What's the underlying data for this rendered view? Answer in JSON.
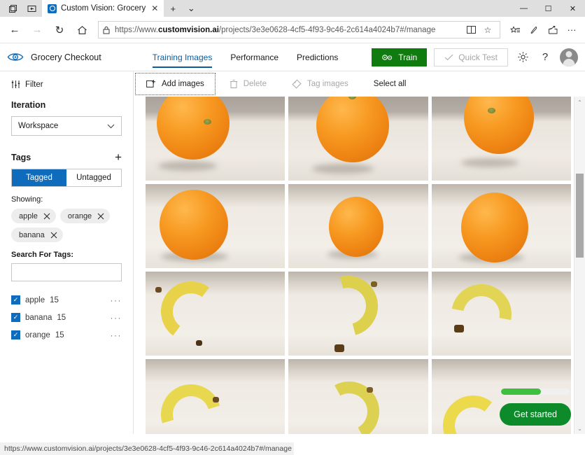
{
  "browser": {
    "window_controls": {
      "minimize": "—",
      "maximize": "☐",
      "close": "✕"
    },
    "tab": {
      "title": "Custom Vision: Grocery",
      "close_label": "✕",
      "favicon_name": "custom-vision-favicon"
    },
    "new_tab_label": "+",
    "tab_menu_label": "⌄",
    "sys_icons": {
      "tab_preview": "⧉",
      "set_aside": "⇤"
    },
    "nav": {
      "back": "←",
      "forward": "→",
      "refresh": "↻",
      "home": "⌂"
    },
    "address": {
      "lock_icon": "🔒",
      "url_scheme": "https://www.",
      "url_domain": "customvision.ai",
      "url_path": "/projects/3e3e0628-4cf5-4f93-9c46-2c614a4024b7#/manage",
      "full_url": "https://www.customvision.ai/projects/3e3e0628-4cf5-4f93-9c46-2c614a4024b7#/manage",
      "reading_view_icon": "▭",
      "favorite_icon": "☆"
    },
    "toolbar_icons": [
      "favorites-hub-icon",
      "notes-pen-icon",
      "share-icon",
      "settings-more-icon"
    ],
    "status_bar_url": "https://www.customvision.ai/projects/3e3e0628-4cf5-4f93-9c46-2c614a4024b7#/manage"
  },
  "app": {
    "logo_name": "custom-vision-eye-logo",
    "project_name": "Grocery Checkout",
    "tabs": [
      {
        "label": "Training Images",
        "active": true
      },
      {
        "label": "Performance",
        "active": false
      },
      {
        "label": "Predictions",
        "active": false
      }
    ],
    "train_button": {
      "label": "Train",
      "icon": "gears-icon",
      "color": "#107c10"
    },
    "quick_test_button": {
      "label": "Quick Test",
      "icon": "check-icon",
      "enabled": false
    },
    "settings_icon": "⚙",
    "help_icon": "?",
    "account_avatar": "user-avatar"
  },
  "sidebar": {
    "filter": {
      "label": "Filter",
      "icon": "filter-icon"
    },
    "iteration": {
      "title": "Iteration",
      "selected": "Workspace",
      "chevron": "⌄"
    },
    "tags": {
      "title": "Tags",
      "add_icon": "+",
      "toggle": {
        "tagged": "Tagged",
        "untagged": "Untagged",
        "selected": "Tagged"
      },
      "showing_label": "Showing:",
      "showing_pills": [
        {
          "label": "apple",
          "remove": "✕"
        },
        {
          "label": "orange",
          "remove": "✕"
        },
        {
          "label": "banana",
          "remove": "✕"
        }
      ],
      "search_label": "Search For Tags:",
      "search_value": "",
      "search_placeholder": "",
      "list": [
        {
          "label": "apple",
          "count": "15",
          "checked": true,
          "more": "···"
        },
        {
          "label": "banana",
          "count": "15",
          "checked": true,
          "more": "···"
        },
        {
          "label": "orange",
          "count": "15",
          "checked": true,
          "more": "···"
        }
      ]
    }
  },
  "commandbar": [
    {
      "label": "Add images",
      "icon": "add-image-icon",
      "enabled": true,
      "focused": true
    },
    {
      "label": "Delete",
      "icon": "trash-icon",
      "enabled": false,
      "focused": false
    },
    {
      "label": "Tag images",
      "icon": "tag-icon",
      "enabled": false,
      "focused": false
    },
    {
      "label": "Select all",
      "icon": "",
      "enabled": true,
      "focused": false
    }
  ],
  "gallery": {
    "columns": 3,
    "images": [
      {
        "tag": "orange",
        "alt": "orange fruit on cloth"
      },
      {
        "tag": "orange",
        "alt": "orange fruit on cloth"
      },
      {
        "tag": "orange",
        "alt": "orange fruit on cloth"
      },
      {
        "tag": "orange",
        "alt": "orange fruit on cloth"
      },
      {
        "tag": "orange",
        "alt": "orange fruit on cloth"
      },
      {
        "tag": "orange",
        "alt": "orange fruit on cloth"
      },
      {
        "tag": "banana",
        "alt": "banana on cloth"
      },
      {
        "tag": "banana",
        "alt": "banana on cloth"
      },
      {
        "tag": "banana",
        "alt": "banana on cloth"
      },
      {
        "tag": "banana",
        "alt": "banana on cloth"
      },
      {
        "tag": "banana",
        "alt": "banana on cloth"
      },
      {
        "tag": "banana",
        "alt": "banana on cloth"
      }
    ],
    "scrollbar": {
      "up_arrow": "⌃",
      "down_arrow": "⌄"
    }
  },
  "widget": {
    "progress_percent": 58,
    "progress_color": "#3fbf3f",
    "get_started_label": "Get started",
    "get_started_color": "#0d8a29"
  }
}
